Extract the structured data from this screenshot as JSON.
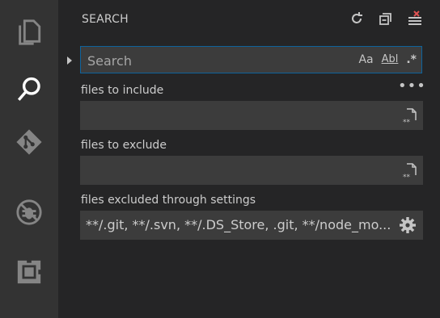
{
  "activity_bar": {
    "items": [
      {
        "icon": "explorer-icon"
      },
      {
        "icon": "search-icon"
      },
      {
        "icon": "git-icon"
      },
      {
        "icon": "debug-icon"
      },
      {
        "icon": "extensions-icon"
      }
    ]
  },
  "sidebar": {
    "title": "SEARCH",
    "actions": [
      "refresh-icon",
      "collapse-all-icon",
      "clear-results-icon"
    ],
    "search": {
      "placeholder": "Search",
      "value": "",
      "match_case_label": "Aa",
      "whole_word_label": "Abl",
      "regex_label": ".*"
    },
    "more_label": "•••",
    "include": {
      "label": "files to include",
      "value": ""
    },
    "exclude": {
      "label": "files to exclude",
      "value": ""
    },
    "excluded_settings": {
      "label": "files excluded through settings",
      "value": "**/.git, **/.svn, **/.DS_Store, .git, **/node_mo..."
    }
  },
  "colors": {
    "activity_bar": "#333333",
    "sidebar": "#252526",
    "input": "#3c3c3c",
    "focus_border": "#0e639c"
  }
}
